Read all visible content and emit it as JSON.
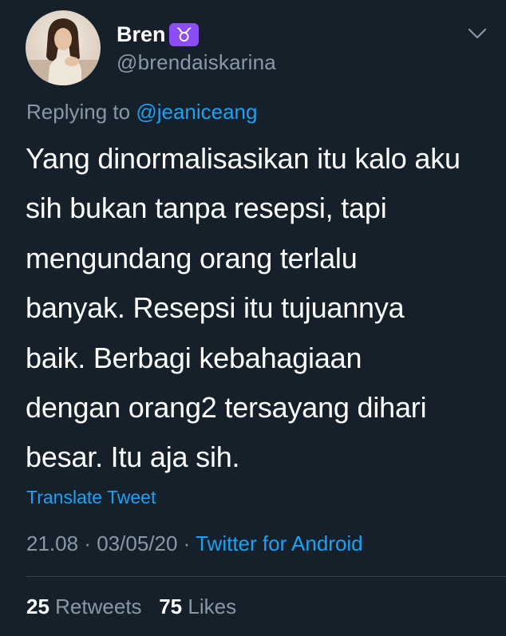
{
  "author": {
    "display_name": "Bren",
    "zodiac_emoji": "♉",
    "handle": "@brendaiskarina"
  },
  "reply": {
    "prefix": "Replying to",
    "mention": "@jeaniceang"
  },
  "tweet": {
    "lines": [
      "Yang dinormalisasikan itu kalo aku",
      "sih bukan tanpa resepsi, tapi",
      "mengundang orang terlalu",
      "banyak. Resepsi itu tujuannya",
      "baik. Berbagi kebahagiaan",
      "dengan orang2 tersayang dihari",
      "besar. Itu aja sih."
    ],
    "translate_label": "Translate Tweet"
  },
  "meta": {
    "time": "21.08",
    "separator": "·",
    "date": "03/05/20",
    "source": "Twitter for Android"
  },
  "stats": {
    "retweets_count": "25",
    "retweets_label": "Retweets",
    "likes_count": "75",
    "likes_label": "Likes"
  },
  "colors": {
    "background": "#15202b",
    "text_primary": "#ffffff",
    "text_secondary": "#8899a6",
    "accent": "#1da1f2",
    "divider": "#38444d",
    "zodiac_badge": "#8c4df5"
  },
  "icons": {
    "menu": "chevron-down-icon"
  }
}
